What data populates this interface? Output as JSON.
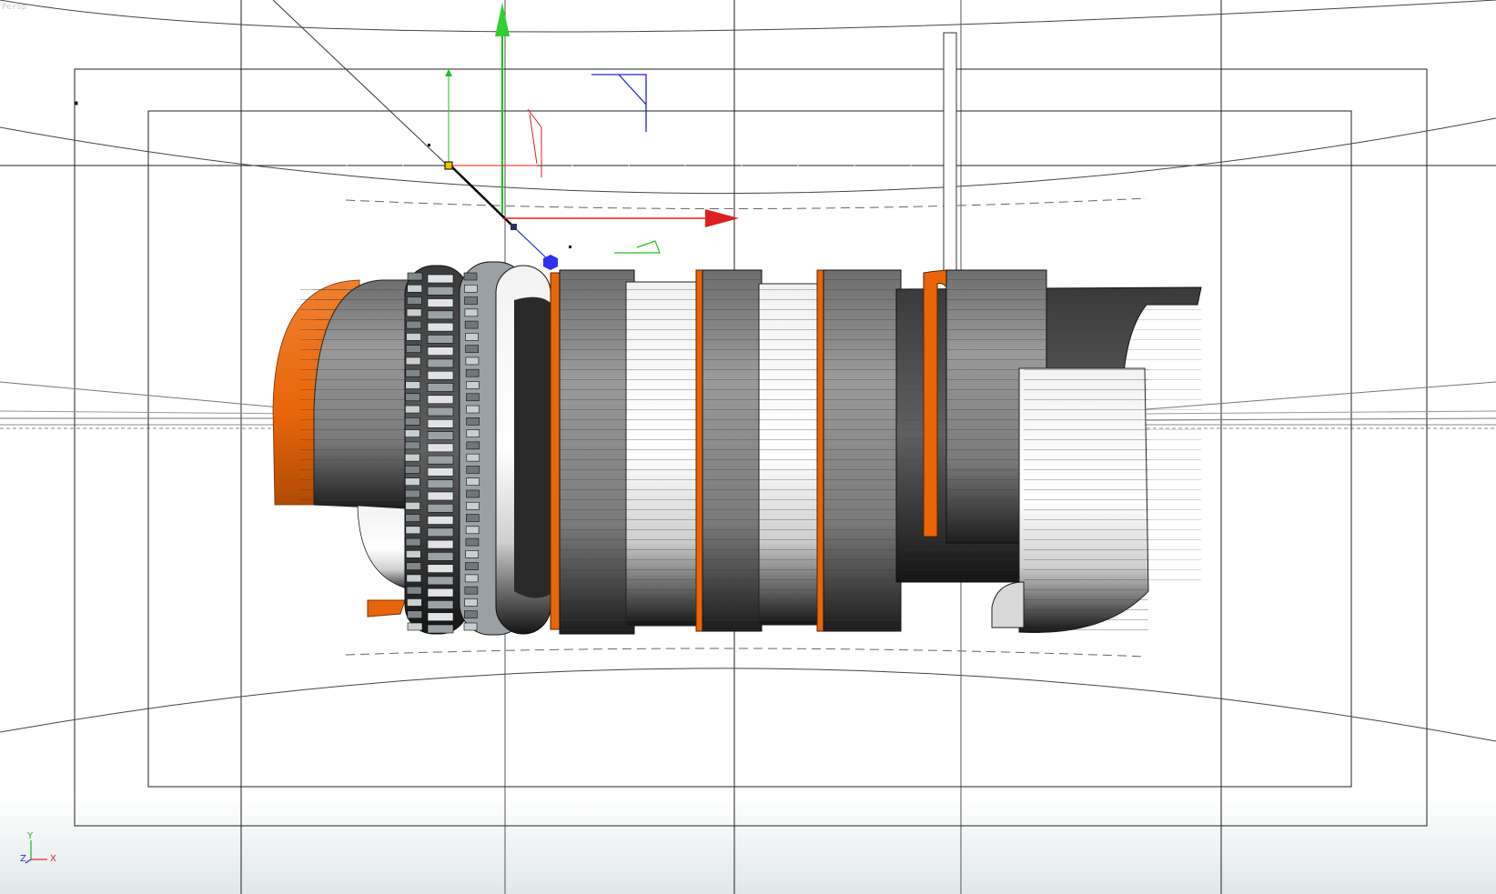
{
  "viewport": {
    "label": "Persp",
    "background_top": "#ffffff",
    "background_bottom": "#e2e8ea"
  },
  "scene": {
    "object_type": "lightsaber-hilt-model",
    "colors": {
      "accent_orange": "#e8650a",
      "ring_gray": "#8c8c8c",
      "ring_dark": "#2e2e2e",
      "gizmo_x": "#e02020",
      "gizmo_y": "#20c020",
      "gizmo_z": "#2020e0",
      "wire": "#1a1a1a"
    }
  },
  "gizmo": {
    "type": "move-transform-gizmo"
  },
  "axis_triad": {
    "y_label": "Y",
    "x_label": "X",
    "z_label": "Z",
    "y_color": "#2fb82f",
    "x_color": "#d33030",
    "z_color": "#3030d0"
  }
}
